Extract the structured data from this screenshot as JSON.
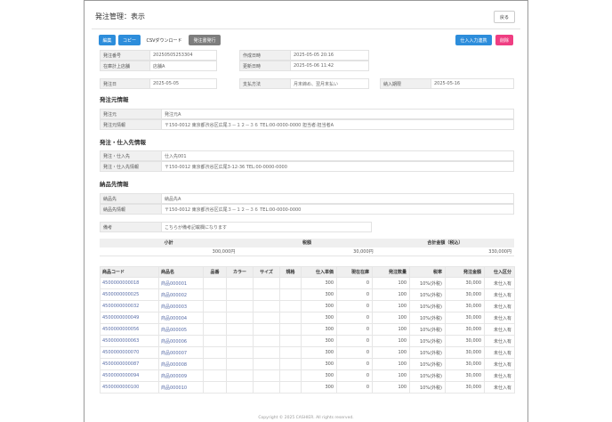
{
  "page": {
    "title": "発注管理：表示",
    "back_label": "戻る"
  },
  "toolbar": {
    "edit": "編集",
    "copy": "コピー",
    "csv": "CSVダウンロード",
    "issue": "発注書発行",
    "link": "仕入入力連携",
    "delete": "削除"
  },
  "header_fields": {
    "order_no_label": "発注番号",
    "order_no": "20250505253304",
    "store_label": "在庫計上店舗",
    "store": "店舗A",
    "created_label": "作成日時",
    "created": "2025-05-05 20:16",
    "updated_label": "更新日時",
    "updated": "2025-05-06 11:42",
    "order_date_label": "発注日",
    "order_date": "2025-05-05",
    "payment_label": "支払方法",
    "payment": "月末締め、翌月末払い",
    "delivery_label": "納入期限",
    "delivery": "2025-05-16"
  },
  "orderer": {
    "heading": "発注元情報",
    "name_label": "発注元",
    "name": "発注元A",
    "info_label": "発注元情報",
    "info": "〒150-0012 東京都渋谷区広尾３－１２－３６ TEL:00-0000-0000 担当者:担当者A"
  },
  "supplier": {
    "heading": "発注・仕入先情報",
    "name_label": "発注・仕入先",
    "name": "仕入先001",
    "info_label": "発注・仕入先情報",
    "info": "〒150-0012 東京都渋谷区広尾3-12-36 TEL:00-0000-0000"
  },
  "delivery_info": {
    "heading": "納品先情報",
    "name_label": "納品先",
    "name": "納品先A",
    "info_label": "納品先情報",
    "info": "〒150-0012 東京都渋谷区広尾３－１２－３６ TEL:00-0000-0000"
  },
  "note": {
    "label": "備考",
    "value": "こちらが備考記載欄になります"
  },
  "totals": {
    "subtotal_label": "小計",
    "tax_label": "税額",
    "total_label": "合計金額（税込）",
    "subtotal": "300,000円",
    "tax": "30,000円",
    "total": "330,000円"
  },
  "table": {
    "headers": [
      "商品コード",
      "商品名",
      "品番",
      "カラー",
      "サイズ",
      "規格",
      "仕入単価",
      "現在在庫",
      "発注数量",
      "税率",
      "発注金額",
      "仕入区分"
    ],
    "rows": [
      [
        "4500000000018",
        "商品000001",
        "",
        "",
        "",
        "",
        "300",
        "0",
        "100",
        "10%(外税)",
        "30,000",
        "未仕入有"
      ],
      [
        "4500000000025",
        "商品000002",
        "",
        "",
        "",
        "",
        "300",
        "0",
        "100",
        "10%(外税)",
        "30,000",
        "未仕入有"
      ],
      [
        "4500000000032",
        "商品000003",
        "",
        "",
        "",
        "",
        "300",
        "0",
        "100",
        "10%(外税)",
        "30,000",
        "未仕入有"
      ],
      [
        "4500000000049",
        "商品000004",
        "",
        "",
        "",
        "",
        "300",
        "0",
        "100",
        "10%(外税)",
        "30,000",
        "未仕入有"
      ],
      [
        "4500000000056",
        "商品000005",
        "",
        "",
        "",
        "",
        "300",
        "0",
        "100",
        "10%(外税)",
        "30,000",
        "未仕入有"
      ],
      [
        "4500000000063",
        "商品000006",
        "",
        "",
        "",
        "",
        "300",
        "0",
        "100",
        "10%(外税)",
        "30,000",
        "未仕入有"
      ],
      [
        "4500000000070",
        "商品000007",
        "",
        "",
        "",
        "",
        "300",
        "0",
        "100",
        "10%(外税)",
        "30,000",
        "未仕入有"
      ],
      [
        "4500000000087",
        "商品000008",
        "",
        "",
        "",
        "",
        "300",
        "0",
        "100",
        "10%(外税)",
        "30,000",
        "未仕入有"
      ],
      [
        "4500000000094",
        "商品000009",
        "",
        "",
        "",
        "",
        "300",
        "0",
        "100",
        "10%(外税)",
        "30,000",
        "未仕入有"
      ],
      [
        "4500000000100",
        "商品000010",
        "",
        "",
        "",
        "",
        "300",
        "0",
        "100",
        "10%(外税)",
        "30,000",
        "未仕入有"
      ]
    ]
  },
  "footer": {
    "text": "Copyright © 2025 CASHIER. All rights reserved."
  }
}
